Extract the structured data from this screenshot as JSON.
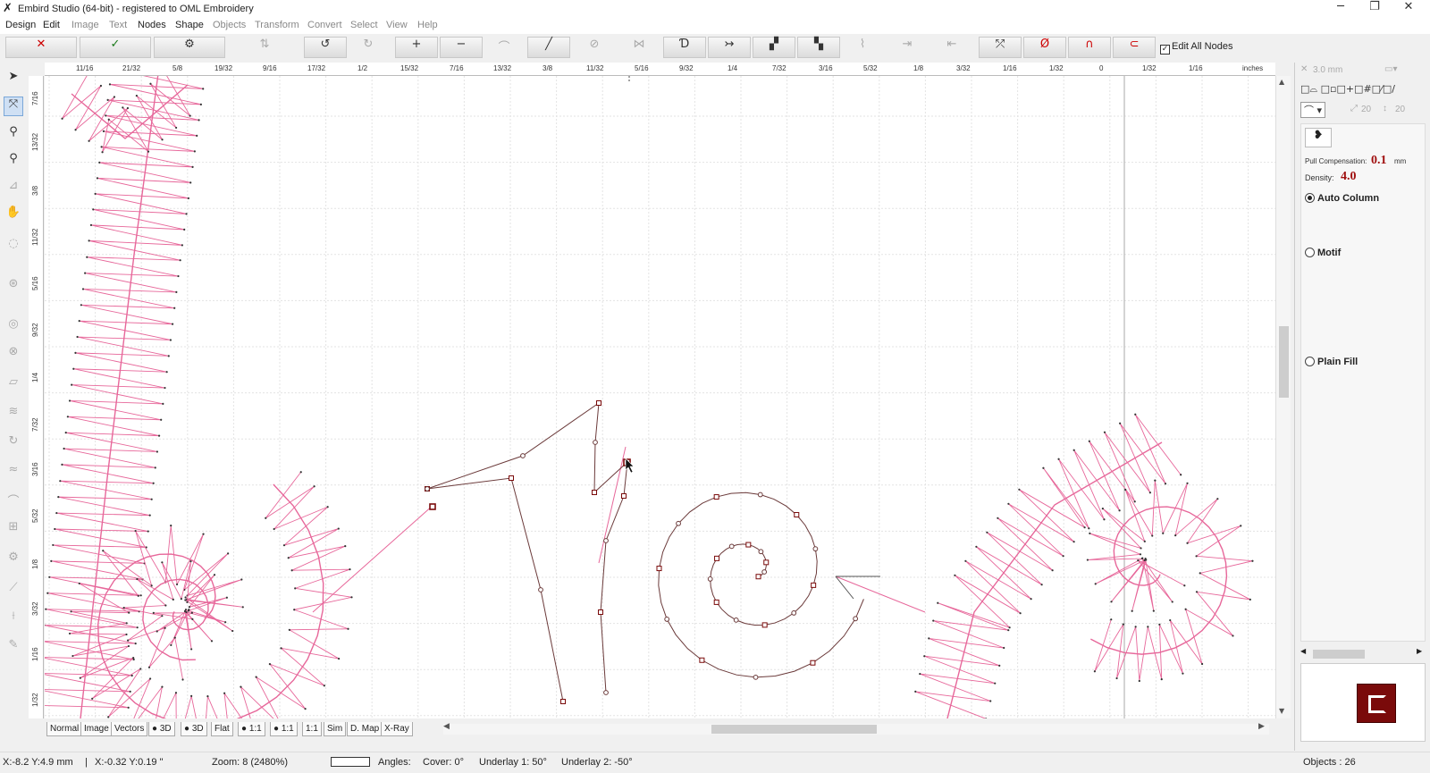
{
  "window": {
    "title": "Embird Studio (64-bit)  - registered to OML Embroidery",
    "minimize": "─",
    "restore": "❐",
    "close": "✕"
  },
  "menu": {
    "items": [
      "Design",
      "Edit",
      "Image",
      "Text",
      "Nodes",
      "Shape",
      "Objects",
      "Transform",
      "Convert",
      "Select",
      "View",
      "Help"
    ]
  },
  "toolbar": {
    "cancel_icon": "✕",
    "ok_icon": "✓",
    "edit_all_nodes_label": "Edit All Nodes",
    "edit_all_nodes_checked": "✓"
  },
  "ruler": {
    "units": "inches",
    "h_ticks": [
      "11/16",
      "21/32",
      "5/8",
      "19/32",
      "9/16",
      "17/32",
      "1/2",
      "15/32",
      "7/16",
      "13/32",
      "3/8",
      "11/32",
      "5/16",
      "9/32",
      "1/4",
      "7/32",
      "3/16",
      "5/32",
      "1/8",
      "3/32",
      "1/16",
      "1/32",
      "0",
      "1/32",
      "1/16"
    ],
    "v_ticks": [
      "7/16",
      "13/32",
      "3/8",
      "11/32",
      "5/16",
      "9/32",
      "1/4",
      "7/32",
      "3/16",
      "5/32",
      "1/8",
      "3/32",
      "1/16",
      "1/32"
    ]
  },
  "view_tabs": [
    "Normal",
    "Image",
    "Vectors",
    "3D",
    "3D",
    "Flat",
    "1:1",
    "1:1",
    "1:1",
    "Sim",
    "D. Map",
    "X-Ray"
  ],
  "status": {
    "coords_mm": "X:-8.2  Y:4.9 mm",
    "coords_in": "X:-0.32  Y:0.19 \"",
    "zoom": "Zoom:  8 (2480%)",
    "angles_label": "Angles:",
    "cover": "Cover:  0°",
    "underlay1": "Underlay 1:  50°",
    "underlay2": "Underlay 2:  -50°",
    "objects": "Objects : 26"
  },
  "right_panel": {
    "size_value": "3.0 mm",
    "v1": "20",
    "v2": "20",
    "pull_comp_label": "Pull Compensation:",
    "pull_comp_value": "0.1",
    "pull_comp_unit": "mm",
    "density_label": "Density:",
    "density_value": "4.0",
    "options": [
      {
        "label": "Auto Column",
        "selected": true
      },
      {
        "label": "Motif",
        "selected": false
      },
      {
        "label": "Plain Fill",
        "selected": false
      }
    ]
  },
  "colors": {
    "stitch_pink": "#e7679a",
    "node_dark_red": "#7a0a0a",
    "path_brown": "#6b3a3a",
    "grid": "#e3e3e3"
  }
}
